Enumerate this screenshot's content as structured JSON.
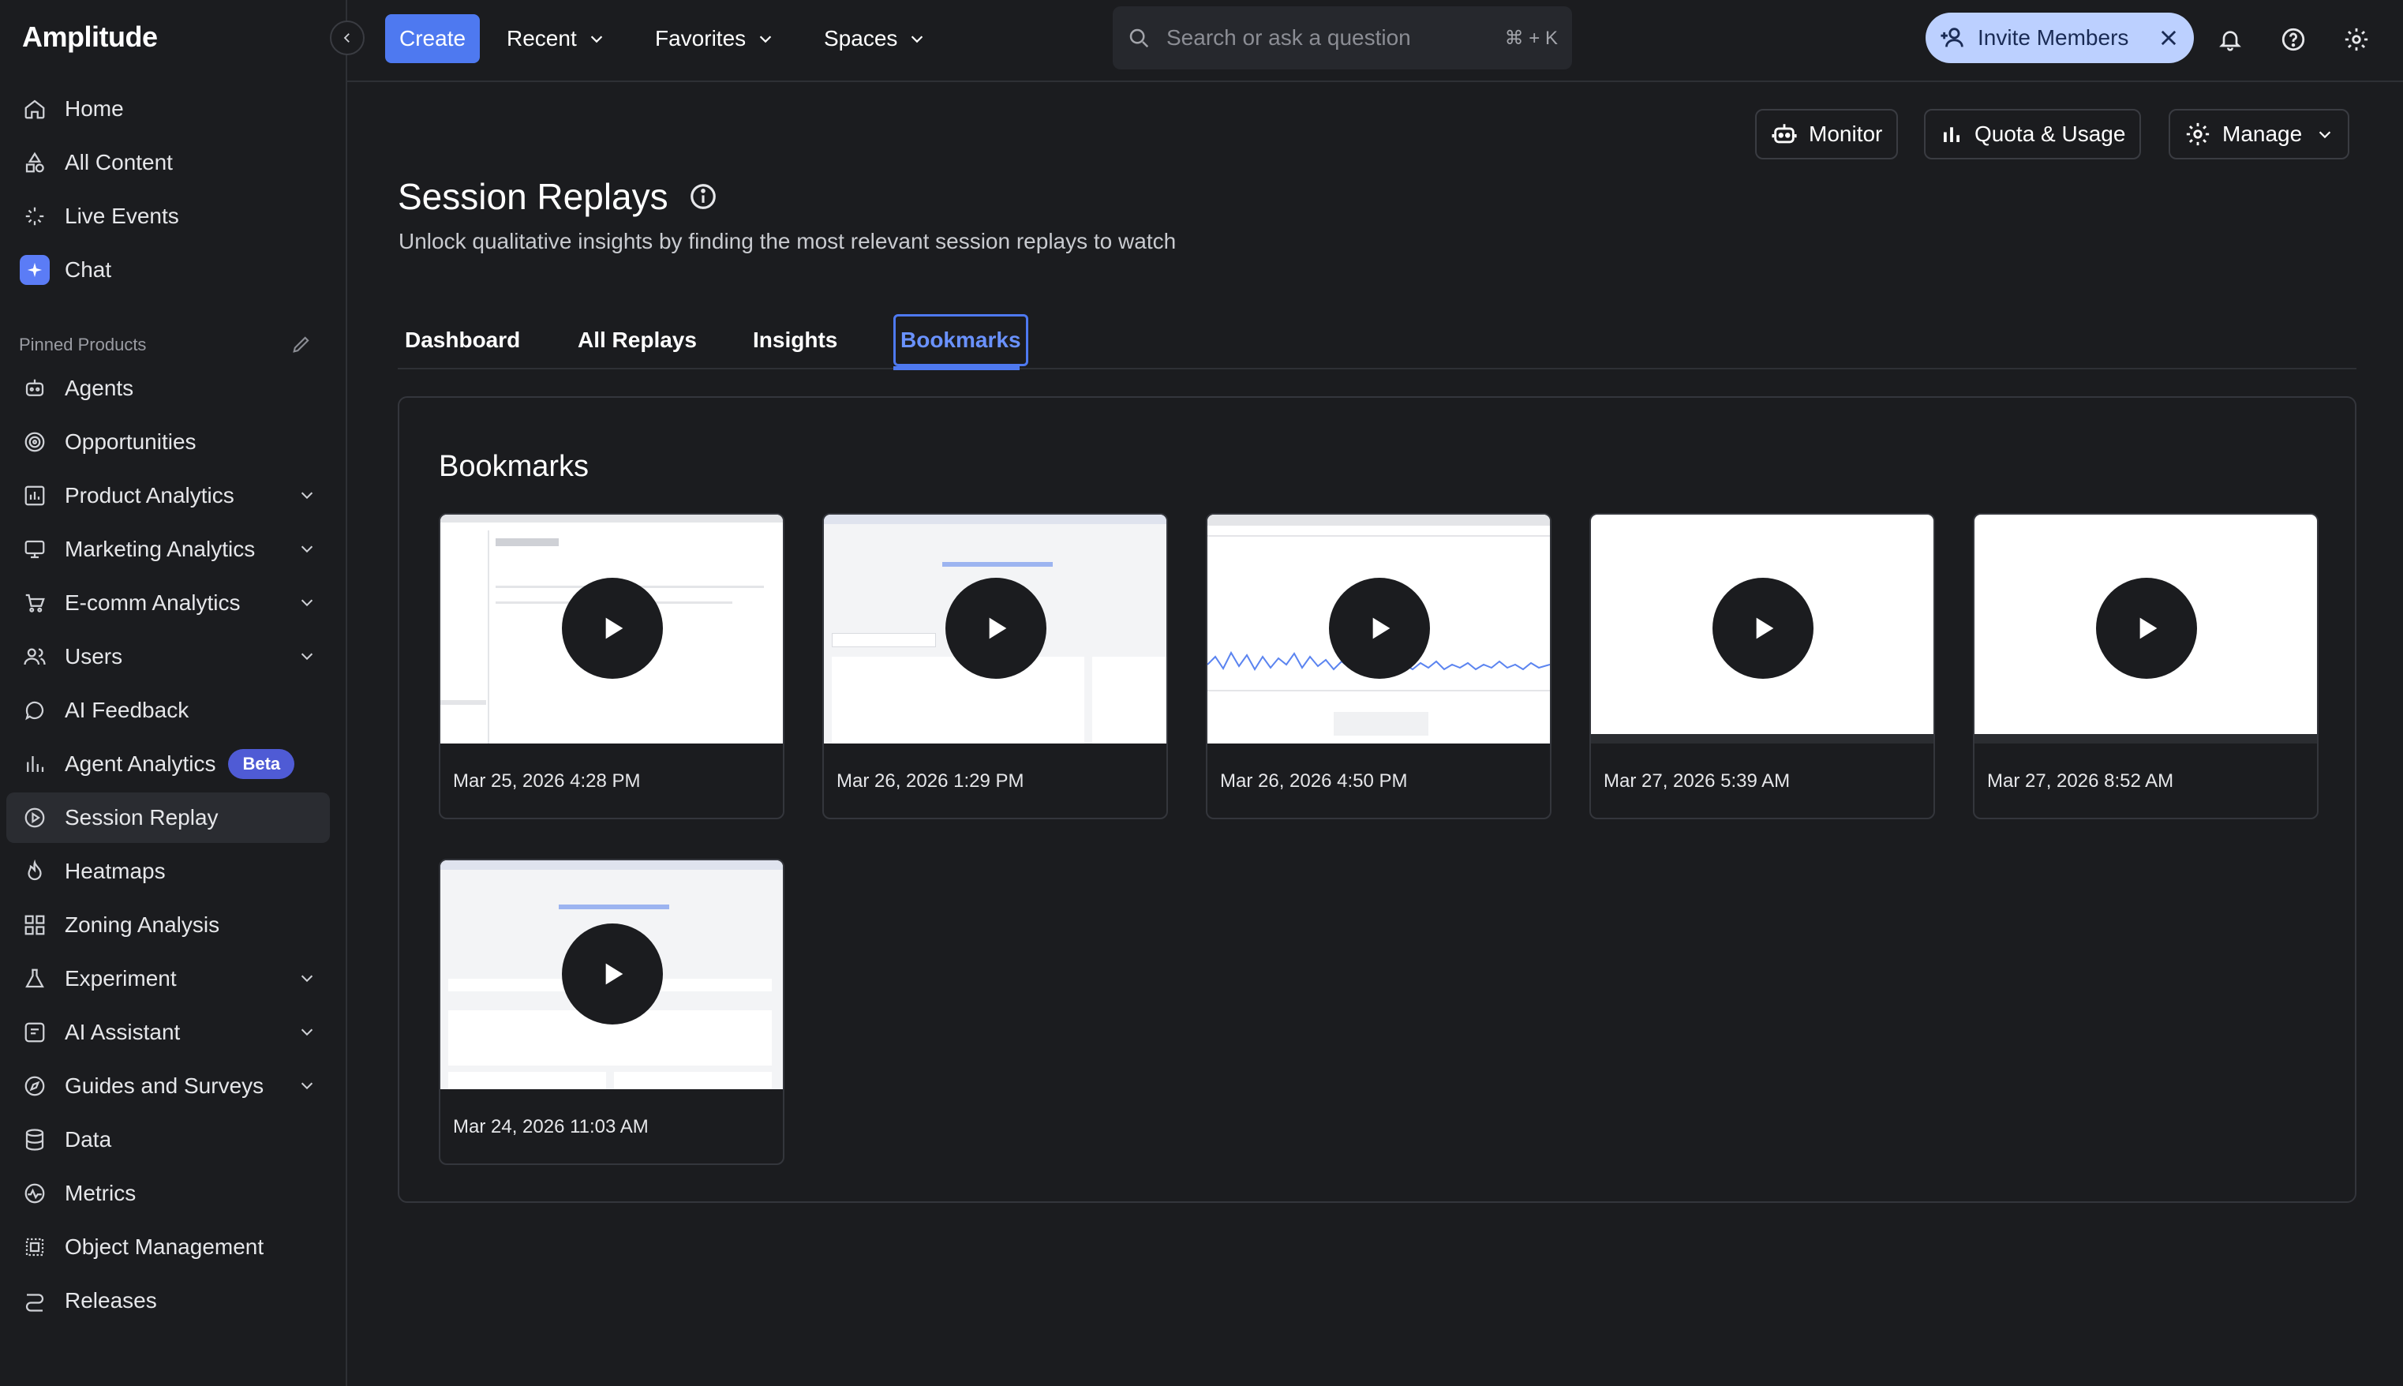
{
  "app": {
    "logo": "Amplitude"
  },
  "sidebar": {
    "items": [
      {
        "label": "Home",
        "icon": "home-icon"
      },
      {
        "label": "All Content",
        "icon": "shapes-icon"
      },
      {
        "label": "Live Events",
        "icon": "sparkle-icon"
      },
      {
        "label": "Chat",
        "icon": "chat-icon"
      }
    ],
    "pinned_header": "Pinned Products",
    "pinned": [
      {
        "label": "Agents",
        "icon": "robot-icon",
        "chevron": false
      },
      {
        "label": "Opportunities",
        "icon": "target-icon",
        "chevron": false
      },
      {
        "label": "Product Analytics",
        "icon": "bar-chart-icon",
        "chevron": true
      },
      {
        "label": "Marketing Analytics",
        "icon": "monitor-icon",
        "chevron": true
      },
      {
        "label": "E-comm Analytics",
        "icon": "cart-icon",
        "chevron": true
      },
      {
        "label": "Users",
        "icon": "users-icon",
        "chevron": true
      },
      {
        "label": "AI Feedback",
        "icon": "feedback-icon",
        "chevron": false
      },
      {
        "label": "Agent Analytics",
        "icon": "agent-analytics-icon",
        "chevron": false,
        "badge": "Beta"
      },
      {
        "label": "Session Replay",
        "icon": "play-circle-icon",
        "chevron": false,
        "active": true
      },
      {
        "label": "Heatmaps",
        "icon": "flame-icon",
        "chevron": false
      },
      {
        "label": "Zoning Analysis",
        "icon": "grid-icon",
        "chevron": false
      },
      {
        "label": "Experiment",
        "icon": "flask-icon",
        "chevron": true
      },
      {
        "label": "AI Assistant",
        "icon": "assistant-icon",
        "chevron": true
      },
      {
        "label": "Guides and Surveys",
        "icon": "compass-icon",
        "chevron": true
      },
      {
        "label": "Data",
        "icon": "database-icon",
        "chevron": false
      },
      {
        "label": "Metrics",
        "icon": "metrics-icon",
        "chevron": false
      },
      {
        "label": "Object Management",
        "icon": "object-icon",
        "chevron": false
      },
      {
        "label": "Releases",
        "icon": "releases-icon",
        "chevron": false
      }
    ]
  },
  "topbar": {
    "create": "Create",
    "menus": [
      "Recent",
      "Favorites",
      "Spaces"
    ],
    "search_placeholder": "Search or ask a question",
    "search_shortcut": "⌘ + K",
    "invite": "Invite Members"
  },
  "header_actions": {
    "monitor": "Monitor",
    "quota": "Quota & Usage",
    "manage": "Manage"
  },
  "page": {
    "title": "Session Replays",
    "subtitle": "Unlock qualitative insights by finding the most relevant session replays to watch"
  },
  "tabs": [
    {
      "label": "Dashboard"
    },
    {
      "label": "All Replays"
    },
    {
      "label": "Insights"
    },
    {
      "label": "Bookmarks",
      "active": true
    }
  ],
  "bookmarks": {
    "title": "Bookmarks",
    "cards": [
      {
        "date": "Mar 25, 2026 4:28 PM"
      },
      {
        "date": "Mar 26, 2026 1:29 PM"
      },
      {
        "date": "Mar 26, 2026 4:50 PM"
      },
      {
        "date": "Mar 27, 2026 5:39 AM"
      },
      {
        "date": "Mar 27, 2026 8:52 AM"
      },
      {
        "date": "Mar 24, 2026 11:03 AM"
      }
    ]
  },
  "colors": {
    "background": "#1b1c1f",
    "accent": "#4e79f0",
    "invite_bg": "#bcd0ff",
    "beta_badge": "#4f5bd5"
  }
}
